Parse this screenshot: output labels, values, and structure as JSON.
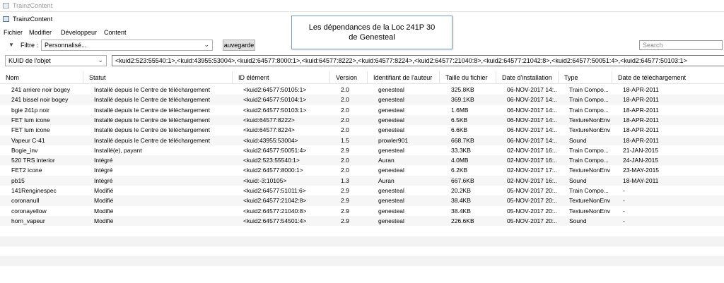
{
  "window": {
    "outer_title": "TrainzContent",
    "inner_title": "TrainzContent"
  },
  "menu": [
    "Fichier",
    "Modifier",
    "Développeur",
    "Content"
  ],
  "filter": {
    "label": "Filtre :",
    "value": "Personnalisé...",
    "save_label": "auvegarde",
    "search_placeholder": "Search"
  },
  "kuid": {
    "select_value": "KUID de l'objet",
    "field_value": "<kuid2:523:55540:1>,<kuid:43955:53004>,<kuid2:64577:8000:1>,<kuid:64577:8222>,<kuid:64577:8224>,<kuid2:64577:21040:8>,<kuid2:64577:21042:8>,<kuid2:64577:50051:4>,<kuid2:64577:50103:1>"
  },
  "tooltip": {
    "line1": "Les dépendances de la Loc 241P 30",
    "line2": "de Genesteal"
  },
  "columns": [
    "Nom",
    "Statut",
    "ID élément",
    "Version",
    "Identifiant de l'auteur",
    "Taille du fichier",
    "Date d'installation",
    "Type",
    "Date de téléchargement"
  ],
  "rows": [
    [
      "241 arriere noir bogey",
      "Installé depuis le Centre de téléchargement",
      "<kuid2:64577:50105:1>",
      "2.0",
      "genesteal",
      "325.8KB",
      "06-NOV-2017 14:...",
      "Train Compo...",
      "18-APR-2011"
    ],
    [
      "241 bissel noir bogey",
      "Installé depuis le Centre de téléchargement",
      "<kuid2:64577:50104:1>",
      "2.0",
      "genesteal",
      "369.1KB",
      "06-NOV-2017 14:...",
      "Train Compo...",
      "18-APR-2011"
    ],
    [
      "bgie 241p noir",
      "Installé depuis le Centre de téléchargement",
      "<kuid2:64577:50103:1>",
      "2.0",
      "genesteal",
      "1.6MB",
      "06-NOV-2017 14:...",
      "Train Compo...",
      "18-APR-2011"
    ],
    [
      "FET lum icone",
      "Installé depuis le Centre de téléchargement",
      "<kuid:64577:8222>",
      "2.0",
      "genesteal",
      "6.5KB",
      "06-NOV-2017 14:...",
      "TextureNonEnv",
      "18-APR-2011"
    ],
    [
      "FET lum icone",
      "Installé depuis le Centre de téléchargement",
      "<kuid:64577:8224>",
      "2.0",
      "genesteal",
      "6.6KB",
      "06-NOV-2017 14:...",
      "TextureNonEnv",
      "18-APR-2011"
    ],
    [
      "Vapeur C-41",
      "Installé depuis le Centre de téléchargement",
      "<kuid:43955:53004>",
      "1.5",
      "prowler901",
      "668.7KB",
      "06-NOV-2017 14:...",
      "Sound",
      "18-APR-2011"
    ],
    [
      "Bogie_inv",
      "Installé(e), payant",
      "<kuid2:64577:50051:4>",
      "2.9",
      "genesteal",
      "33.3KB",
      "02-NOV-2017 16:...",
      "Train Compo...",
      "21-JAN-2015"
    ],
    [
      "520 TRS interior",
      "Intégré",
      "<kuid2:523:55540:1>",
      "2.0",
      "Auran",
      "4.0MB",
      "02-NOV-2017 16:...",
      "Train Compo...",
      "24-JAN-2015"
    ],
    [
      "FET2 icone",
      "Intégré",
      "<kuid2:64577:8000:1>",
      "2.0",
      "genesteal",
      "6.2KB",
      "02-NOV-2017 17:...",
      "TextureNonEnv",
      "23-MAY-2015"
    ],
    [
      "pb15",
      "Intégré",
      "<kuid:-3:10105>",
      "1.3",
      "Auran",
      "667.6KB",
      "02-NOV-2017 16:...",
      "Sound",
      "18-MAY-2011"
    ],
    [
      "141Renginespec",
      "Modifié",
      "<kuid2:64577:51011:6>",
      "2.9",
      "genesteal",
      "20.2KB",
      "05-NOV-2017 20:...",
      "Train Compo...",
      "-"
    ],
    [
      "coronanull",
      "Modifié",
      "<kuid2:64577:21042:8>",
      "2.9",
      "genesteal",
      "38.4KB",
      "05-NOV-2017 20:...",
      "TextureNonEnv",
      "-"
    ],
    [
      "coronayellow",
      "Modifié",
      "<kuid2:64577:21040:8>",
      "2.9",
      "genesteal",
      "38.4KB",
      "05-NOV-2017 20:...",
      "TextureNonEnv",
      "-"
    ],
    [
      "horn_vapeur",
      "Modifié",
      "<kuid2:64577:54501:4>",
      "2.9",
      "genesteal",
      "226.6KB",
      "05-NOV-2017 20:...",
      "Sound",
      "-"
    ]
  ]
}
